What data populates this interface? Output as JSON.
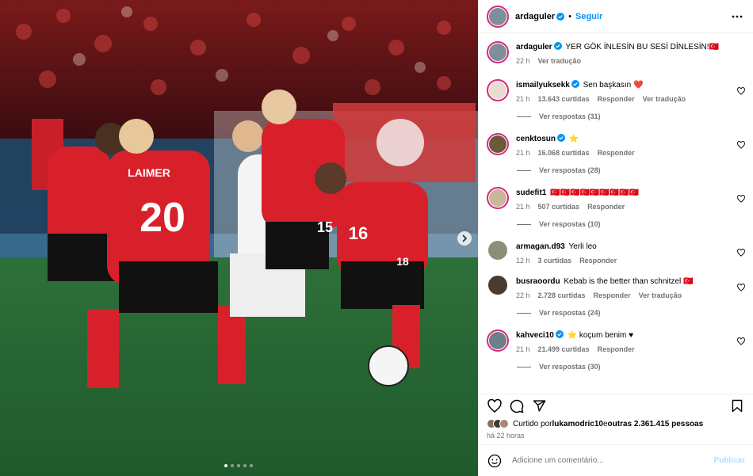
{
  "media": {
    "players": [
      {
        "name_on_shirt": "LAIMER",
        "number": "20"
      },
      {
        "name_on_shirt": "",
        "number": "16"
      },
      {
        "name_on_shirt": "",
        "number": "15"
      },
      {
        "name_on_shirt": "",
        "number": "18"
      }
    ],
    "carousel_dots": 5,
    "active_dot": 0
  },
  "header": {
    "username": "ardaguler",
    "separator": "•",
    "follow_label": "Seguir"
  },
  "caption": {
    "username": "ardaguler",
    "text": "YER GÖK İNLESİN BU SESİ DİNLESİN!🇹🇷",
    "time": "22 h",
    "translate": "Ver tradução"
  },
  "comments": [
    {
      "username": "ismailyuksekk",
      "verified": true,
      "text": "Sen başkasın ❤️",
      "time": "21 h",
      "likes": "13.643 curtidas",
      "reply": "Responder",
      "translate": "Ver tradução",
      "replies": "Ver respostas (31)",
      "ring": true,
      "avatar_color": "#e8dcd0"
    },
    {
      "username": "cenktosun",
      "verified": true,
      "text": "⭐",
      "time": "21 h",
      "likes": "16.068 curtidas",
      "reply": "Responder",
      "translate": "",
      "replies": "Ver respostas (28)",
      "ring": true,
      "avatar_color": "#6b5a3a"
    },
    {
      "username": "sudefit1",
      "verified": false,
      "text": "🇹🇷🇹🇷🇹🇷🇹🇷🇹🇷🇹🇷🇹🇷🇹🇷🇹🇷",
      "time": "21 h",
      "likes": "507 curtidas",
      "reply": "Responder",
      "translate": "",
      "replies": "Ver respostas (10)",
      "ring": true,
      "avatar_color": "#c9b79c"
    },
    {
      "username": "armagan.d93",
      "verified": false,
      "text": "Yerli leo",
      "time": "12 h",
      "likes": "3 curtidas",
      "reply": "Responder",
      "translate": "",
      "replies": "",
      "ring": false,
      "avatar_color": "#8a8f7a"
    },
    {
      "username": "busraoordu",
      "verified": false,
      "text": "Kebab is the better than schnitzel 🇹🇷",
      "time": "22 h",
      "likes": "2.728 curtidas",
      "reply": "Responder",
      "translate": "Ver tradução",
      "replies": "Ver respostas (24)",
      "ring": false,
      "avatar_color": "#4a3a30"
    },
    {
      "username": "kahveci10",
      "verified": true,
      "text": "⭐ koçum benim ♥",
      "time": "21 h",
      "likes": "21.499 curtidas",
      "reply": "Responder",
      "translate": "",
      "replies": "Ver respostas (30)",
      "ring": true,
      "avatar_color": "#6e7f8c"
    }
  ],
  "likes": {
    "prefix": "Curtido por ",
    "user": "lukamodric10",
    "middle": " e ",
    "others": "outras 2.361.415 pessoas"
  },
  "post_time": "há 22 horas",
  "add_comment": {
    "placeholder": "Adicione um comentário...",
    "post_label": "Publicar"
  },
  "colors": {
    "accent": "#0095f6",
    "heart": "#ff3040",
    "muted": "#737373"
  },
  "icons": [
    "more-icon",
    "heart-icon",
    "comment-icon",
    "share-icon",
    "bookmark-icon",
    "emoji-icon",
    "chevron-right-icon",
    "verified-icon"
  ]
}
